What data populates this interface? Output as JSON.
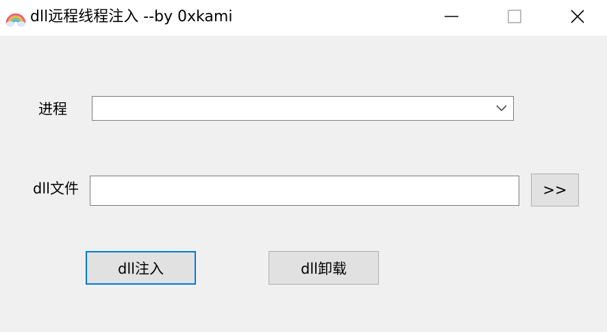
{
  "window": {
    "title": "dll远程线程注入 --by 0xkami",
    "app_icon": "rainbow-icon",
    "controls": [
      "minimize-icon",
      "maximize-icon",
      "close-icon"
    ]
  },
  "form": {
    "process_label": "进程",
    "process_value": "",
    "dll_label": "dll文件",
    "dll_path_value": "",
    "browse_label": ">>"
  },
  "actions": {
    "inject_label": "dll注入",
    "unload_label": "dll卸载"
  },
  "colors": {
    "focus_border": "#0078d7",
    "window_bg": "#f0f0f0",
    "titlebar_bg": "#ffffff",
    "button_bg": "#e1e1e1"
  }
}
